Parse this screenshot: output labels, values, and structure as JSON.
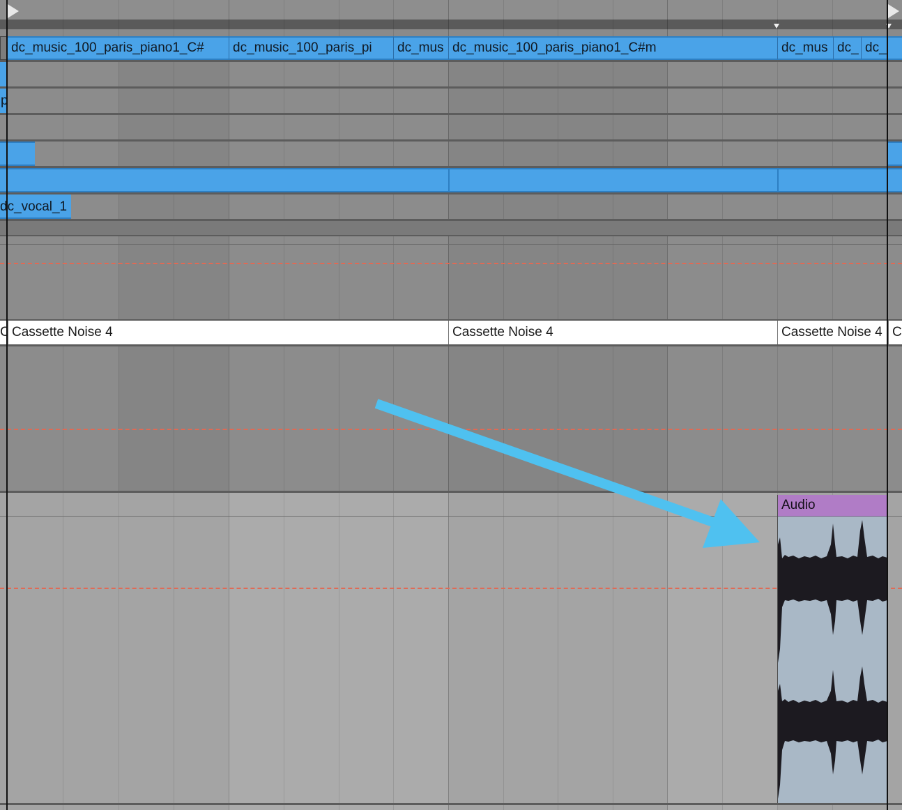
{
  "tracks": {
    "music_row_clips": [
      {
        "label": "dc_music_100_paris_piano1_C#"
      },
      {
        "label": "dc_music_100_paris_pi"
      },
      {
        "label": "dc_mus"
      },
      {
        "label": "dc_music_100_paris_piano1_C#m"
      },
      {
        "label": "dc_mus"
      },
      {
        "label": "dc_"
      },
      {
        "label": "dc_"
      }
    ],
    "partial_clip_label": "p",
    "vocal_clip_label": "dc_vocal_1",
    "noise_clips": [
      {
        "label": "C"
      },
      {
        "label": "Cassette Noise 4"
      },
      {
        "label": "Cassette Noise 4"
      },
      {
        "label": "Cassette Noise 4"
      },
      {
        "label": "Ca"
      }
    ]
  },
  "audio_clip": {
    "label": "Audio",
    "header_color": "#b07cc6",
    "body_color": "#a9b8c6"
  },
  "colors": {
    "clip_blue": "#4aa3e8",
    "arrow": "#4fc1f0",
    "automation_line": "#e06a55"
  }
}
